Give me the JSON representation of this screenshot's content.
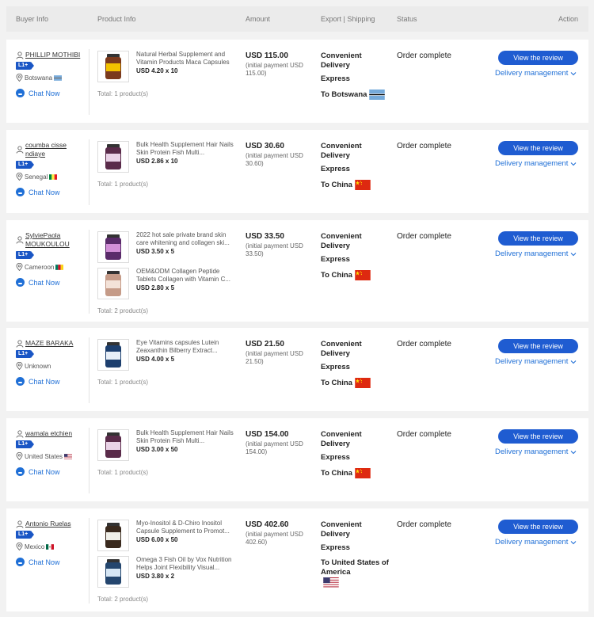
{
  "header": {
    "buyer_info": "Buyer Info",
    "product_info": "Product Info",
    "amount": "Amount",
    "export_shipping": "Export | Shipping",
    "status": "Status",
    "action": "Action"
  },
  "labels": {
    "badge": "L1+",
    "chat": "Chat Now",
    "review": "View the review",
    "delivery": "Delivery management",
    "shipping_type": "Convenient Delivery",
    "express": "Express",
    "status": "Order complete"
  },
  "orders": [
    {
      "buyer": "PHILLIP MOTHIBI",
      "country": "Botswana",
      "products": [
        {
          "title": "Natural Herbal Supplement and Vitamin Products Maca Capsules",
          "price": "USD 4.20 x 10"
        }
      ],
      "total": "Total:  1 product(s)",
      "amount": "USD 115.00",
      "initial": "(initial payment USD 115.00)",
      "dest": "To Botswana"
    },
    {
      "buyer": "coumba cisse ndiaye",
      "country": "Senegal",
      "products": [
        {
          "title": "Bulk Health Supplement Hair Nails Skin Protein Fish Multi...",
          "price": "USD 2.86 x 10"
        }
      ],
      "total": "Total:  1 product(s)",
      "amount": "USD 30.60",
      "initial": "(initial payment USD 30.60)",
      "dest": "To China"
    },
    {
      "buyer": "SylviePaola MOUKOULOU",
      "country": "Cameroon",
      "products": [
        {
          "title": "2022 hot sale private brand skin care whitening and collagen ski...",
          "price": "USD 3.50 x 5"
        },
        {
          "title": "OEM&ODM Collagen Peptide Tablets Collagen with Vitamin C...",
          "price": "USD 2.80 x 5"
        }
      ],
      "total": "Total:  2 product(s)",
      "amount": "USD 33.50",
      "initial": "(initial payment USD 33.50)",
      "dest": "To China"
    },
    {
      "buyer": "MAZE BARAKA",
      "country": "Unknown",
      "products": [
        {
          "title": "Eye Vitamins capsules Lutein Zeaxanthin Bilberry Extract...",
          "price": "USD 4.00 x 5"
        }
      ],
      "total": "Total:  1 product(s)",
      "amount": "USD 21.50",
      "initial": "(initial payment USD 21.50)",
      "dest": "To China"
    },
    {
      "buyer": "wamala etchien",
      "country": "United States",
      "products": [
        {
          "title": "Bulk Health Supplement Hair Nails Skin Protein Fish Multi...",
          "price": "USD 3.00 x 50"
        }
      ],
      "total": "Total:  1 product(s)",
      "amount": "USD 154.00",
      "initial": "(initial payment USD 154.00)",
      "dest": "To China"
    },
    {
      "buyer": "Antonio Ruelas",
      "country": "Mexico",
      "products": [
        {
          "title": "Myo-Inositol & D-Chiro Inositol Capsule Supplement to Promot...",
          "price": "USD 6.00 x 50"
        },
        {
          "title": "Omega 3 Fish Oil by Vox Nutrition Helps Joint Flexibility Visual...",
          "price": "USD 3.80 x 2"
        }
      ],
      "total": "Total:  2 product(s)",
      "amount": "USD 402.60",
      "initial": "(initial payment USD 402.60)",
      "dest": "To United States of America"
    }
  ]
}
